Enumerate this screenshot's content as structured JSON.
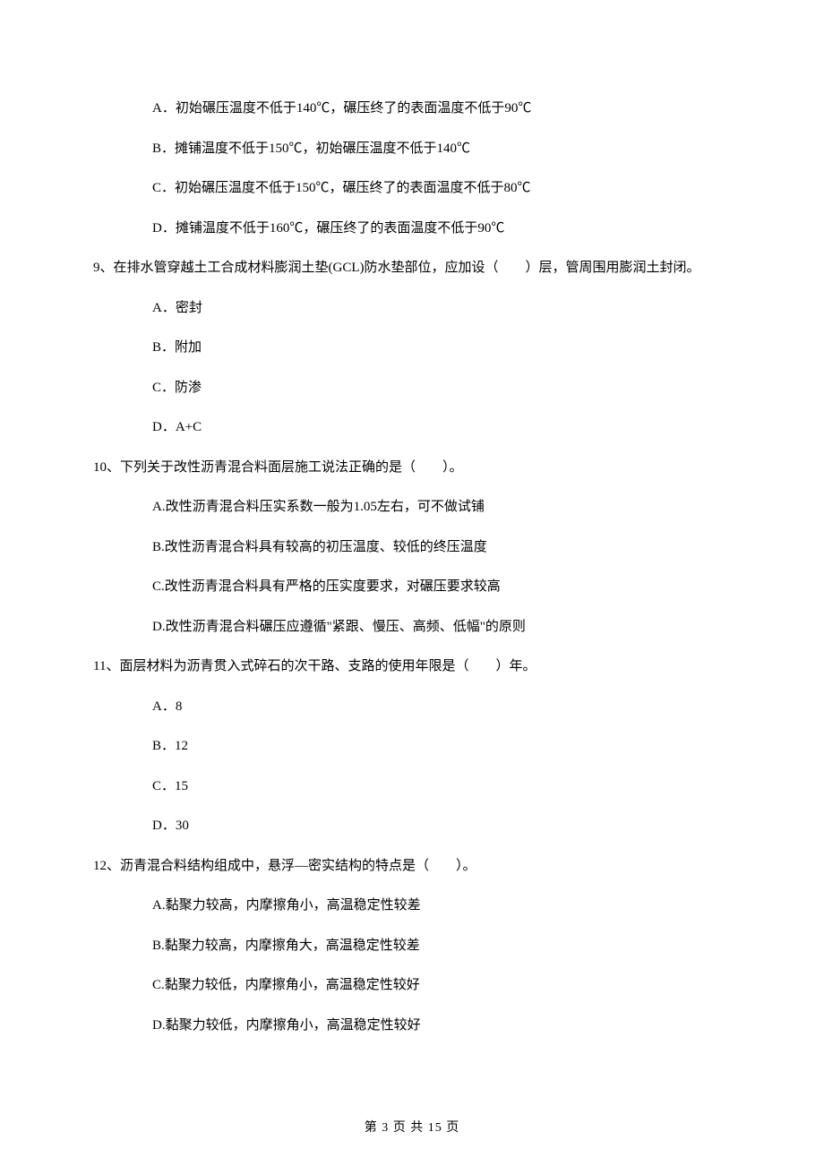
{
  "q8": {
    "A": "A．初始碾压温度不低于140℃，碾压终了的表面温度不低于90℃",
    "B": "B．摊铺温度不低于150℃，初始碾压温度不低于140℃",
    "C": "C．初始碾压温度不低于150℃，碾压终了的表面温度不低于80℃",
    "D": "D．摊铺温度不低于160℃，碾压终了的表面温度不低于90℃"
  },
  "q9": {
    "stem": "9、在排水管穿越土工合成材料膨润土垫(GCL)防水垫部位，应加设（　　）层，管周围用膨润土封闭。",
    "A": "A．密封",
    "B": "B．附加",
    "C": "C．防渗",
    "D": "D．A+C"
  },
  "q10": {
    "stem": "10、下列关于改性沥青混合料面层施工说法正确的是（　　）。",
    "A": "A.改性沥青混合料压实系数一般为1.05左右，可不做试铺",
    "B": "B.改性沥青混合料具有较高的初压温度、较低的终压温度",
    "C": "C.改性沥青混合料具有严格的压实度要求，对碾压要求较高",
    "D": "D.改性沥青混合料碾压应遵循\"紧跟、慢压、高频、低幅\"的原则"
  },
  "q11": {
    "stem": "11、面层材料为沥青贯入式碎石的次干路、支路的使用年限是（　　）年。",
    "A": "A．8",
    "B": "B．12",
    "C": "C．15",
    "D": "D．30"
  },
  "q12": {
    "stem": "12、沥青混合料结构组成中，悬浮—密实结构的特点是（　　）。",
    "A": "A.黏聚力较高，内摩擦角小，高温稳定性较差",
    "B": "B.黏聚力较高，内摩擦角大，高温稳定性较差",
    "C": "C.黏聚力较低，内摩擦角小，高温稳定性较好",
    "D": "D.黏聚力较低，内摩擦角小，高温稳定性较好"
  },
  "footer": "第 3 页 共 15 页"
}
